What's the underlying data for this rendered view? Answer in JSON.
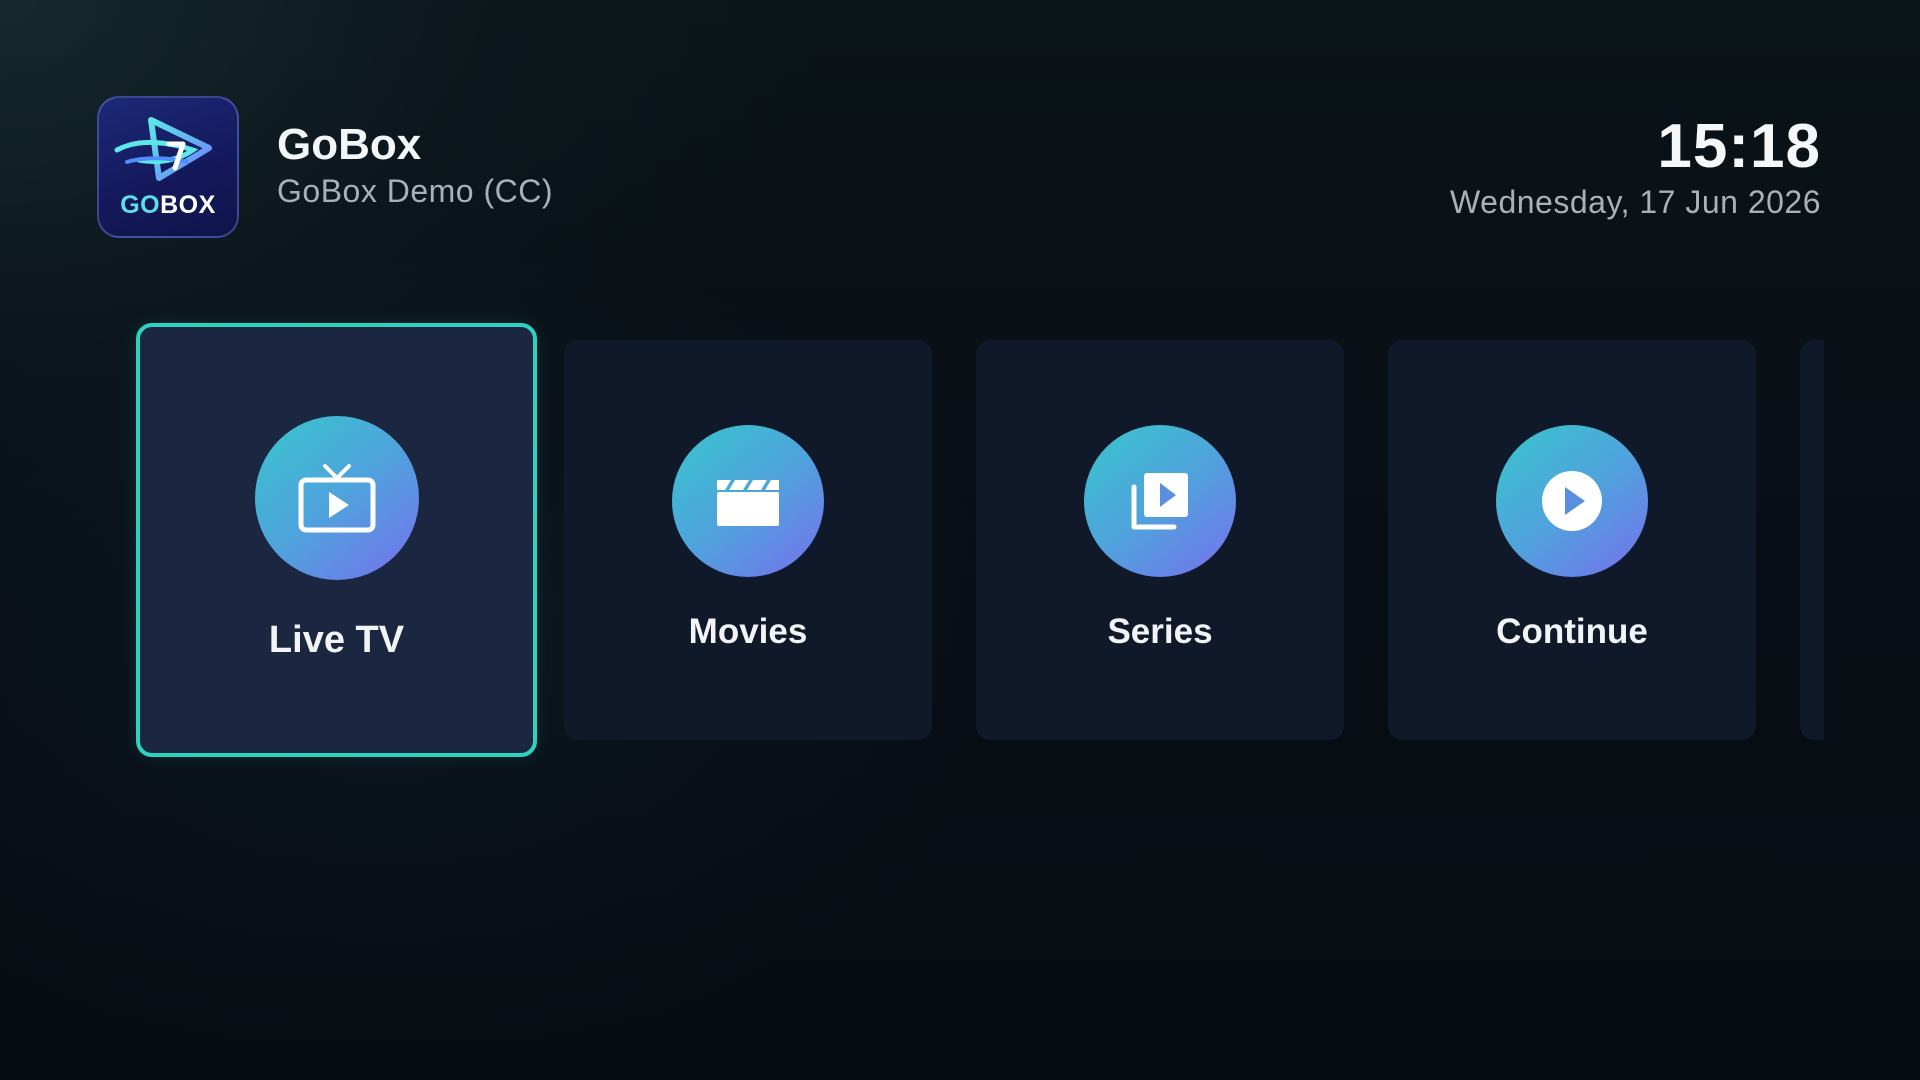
{
  "header": {
    "logo_word_go": "GO",
    "logo_word_box": "BOX",
    "app_name": "GoBox",
    "profile": "GoBox Demo (CC)",
    "time": "15:18",
    "date": "Wednesday, 17 Jun 2026"
  },
  "menu": {
    "items": [
      {
        "label": "Live TV",
        "icon": "live-tv-icon",
        "focused": true
      },
      {
        "label": "Movies",
        "icon": "clapperboard-icon",
        "focused": false
      },
      {
        "label": "Series",
        "icon": "video-library-icon",
        "focused": false
      },
      {
        "label": "Continue",
        "icon": "play-circle-icon",
        "focused": false
      }
    ]
  },
  "colors": {
    "focus_border": "#2dd3bf",
    "tile_background": "#10192a",
    "tile_focused_background": "#1b2640",
    "icon_gradient_start": "#38c6cc",
    "icon_gradient_end": "#7670ee",
    "logo_background": "#14195c"
  }
}
